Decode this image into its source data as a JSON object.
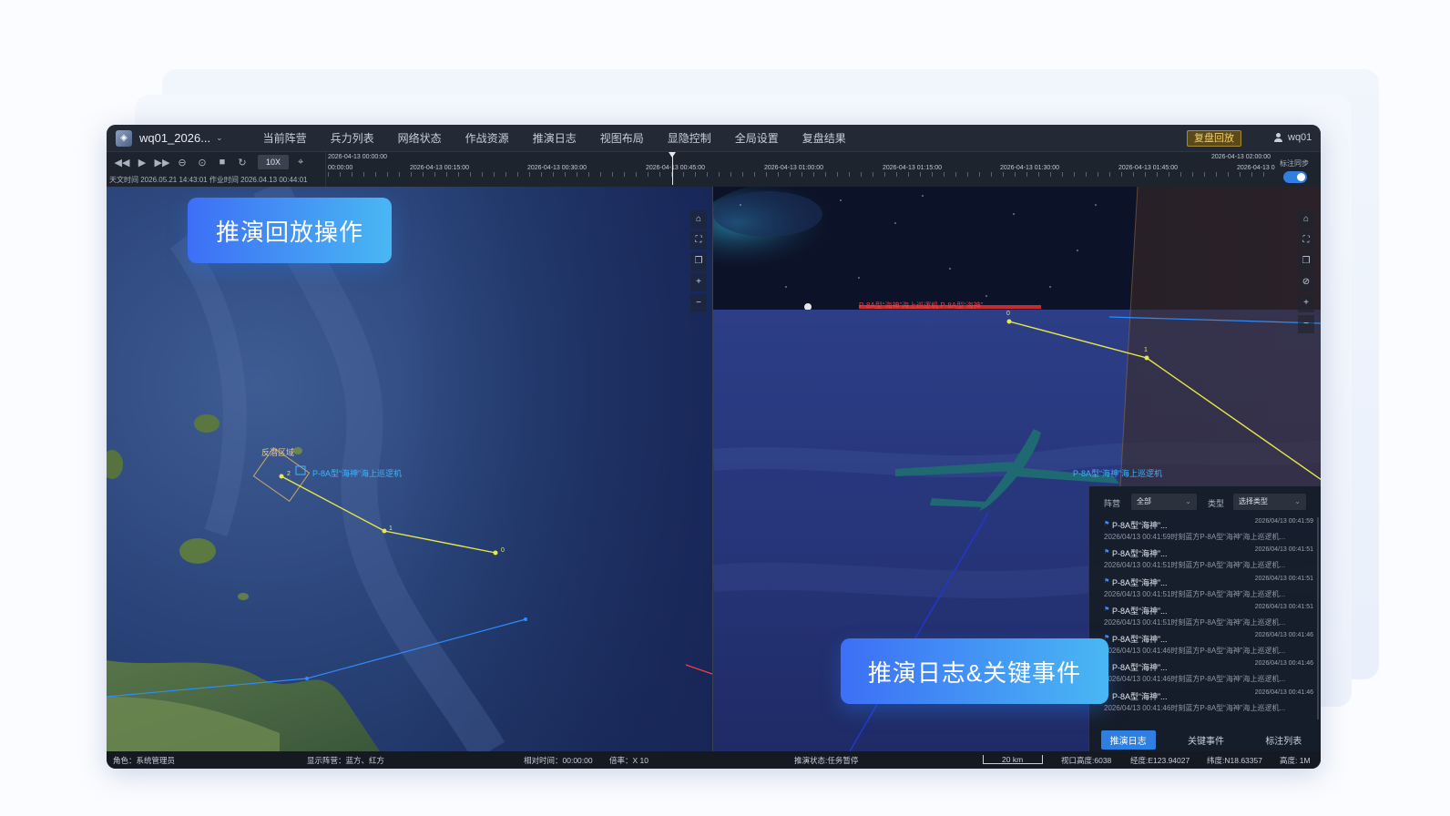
{
  "app": {
    "project_name": "wq01_2026...",
    "menu": [
      "当前阵营",
      "兵力列表",
      "网络状态",
      "作战资源",
      "推演日志",
      "视图布局",
      "显隐控制",
      "全局设置",
      "复盘结果"
    ],
    "replay_badge": "复盘回放",
    "user": "wq01"
  },
  "controls": {
    "speed": "10X",
    "astro_time": "天文时间 2026.05.21 14:43:01 作业时间 2026.04.13 00:44:01",
    "sync_label": "标注同步",
    "sync_on": true
  },
  "timeline": {
    "start_label": "2026-04-13 00:00:00",
    "end_label": "2026-04-13 02:00:00",
    "ticks": [
      "00:00:00",
      "2026-04-13 00:15:00",
      "2026-04-13 00:30:00",
      "2026-04-13 00:45:00",
      "2026-04-13 01:00:00",
      "2026-04-13 01:15:00",
      "2026-04-13 01:30:00",
      "2026-04-13 01:45:00",
      "2026-04-13 0"
    ],
    "playhead_fraction": 0.367
  },
  "map2d": {
    "area_label": "反潜区域",
    "aircraft_label": "P-8A型“海神”海上巡逻机",
    "waypoints": [
      "2",
      "1",
      "0"
    ]
  },
  "view3d": {
    "aircraft_label": "P-8A型“海神”海上巡逻机",
    "horizon_track_label": "P-8A型“海神”海上巡逻机 P-8A型“海神”",
    "waypoints": [
      "0",
      "1"
    ]
  },
  "events": {
    "camp_label": "阵营",
    "camp_value": "全部",
    "type_label": "类型",
    "type_placeholder": "选择类型",
    "items": [
      {
        "name": "P-8A型“海神”...",
        "time": "2026/04/13 00:41:59",
        "desc": "2026/04/13 00:41:59时刻蓝方P-8A型“海神”海上巡逻机..."
      },
      {
        "name": "P-8A型“海神”...",
        "time": "2026/04/13 00:41:51",
        "desc": "2026/04/13 00:41:51时刻蓝方P-8A型“海神”海上巡逻机..."
      },
      {
        "name": "P-8A型“海神”...",
        "time": "2026/04/13 00:41:51",
        "desc": "2026/04/13 00:41:51时刻蓝方P-8A型“海神”海上巡逻机..."
      },
      {
        "name": "P-8A型“海神”...",
        "time": "2026/04/13 00:41:51",
        "desc": "2026/04/13 00:41:51时刻蓝方P-8A型“海神”海上巡逻机..."
      },
      {
        "name": "P-8A型“海神”...",
        "time": "2026/04/13 00:41:46",
        "desc": "2026/04/13 00:41:46时刻蓝方P-8A型“海神”海上巡逻机..."
      },
      {
        "name": "P-8A型“海神”...",
        "time": "2026/04/13 00:41:46",
        "desc": "2026/04/13 00:41:46时刻蓝方P-8A型“海神”海上巡逻机..."
      },
      {
        "name": "P-8A型“海神”...",
        "time": "2026/04/13 00:41:46",
        "desc": "2026/04/13 00:41:46时刻蓝方P-8A型“海神”海上巡逻机..."
      }
    ],
    "tabs": [
      "推演日志",
      "关键事件",
      "标注列表"
    ]
  },
  "status": {
    "role": "角色：系统管理员",
    "display_camps": "显示阵营：蓝方、红方",
    "relative_time": "相对时间：00:00:00",
    "rate": "倍率：X 10",
    "sim_state": "推演状态:任务暂停",
    "scale": "20 km",
    "view_height": "视口高度:6038",
    "longitude": "经度:E123.94027",
    "latitude": "纬度:N18.63357",
    "altitude": "高度: 1M"
  },
  "callouts": {
    "replay": "推演回放操作",
    "log": "推演日志&关键事件"
  },
  "colors": {
    "accent": "#2f7fe3",
    "track_yellow": "#e8e84a",
    "track_blue": "#2f8cff",
    "badge_gold": "#f4cf6a"
  }
}
